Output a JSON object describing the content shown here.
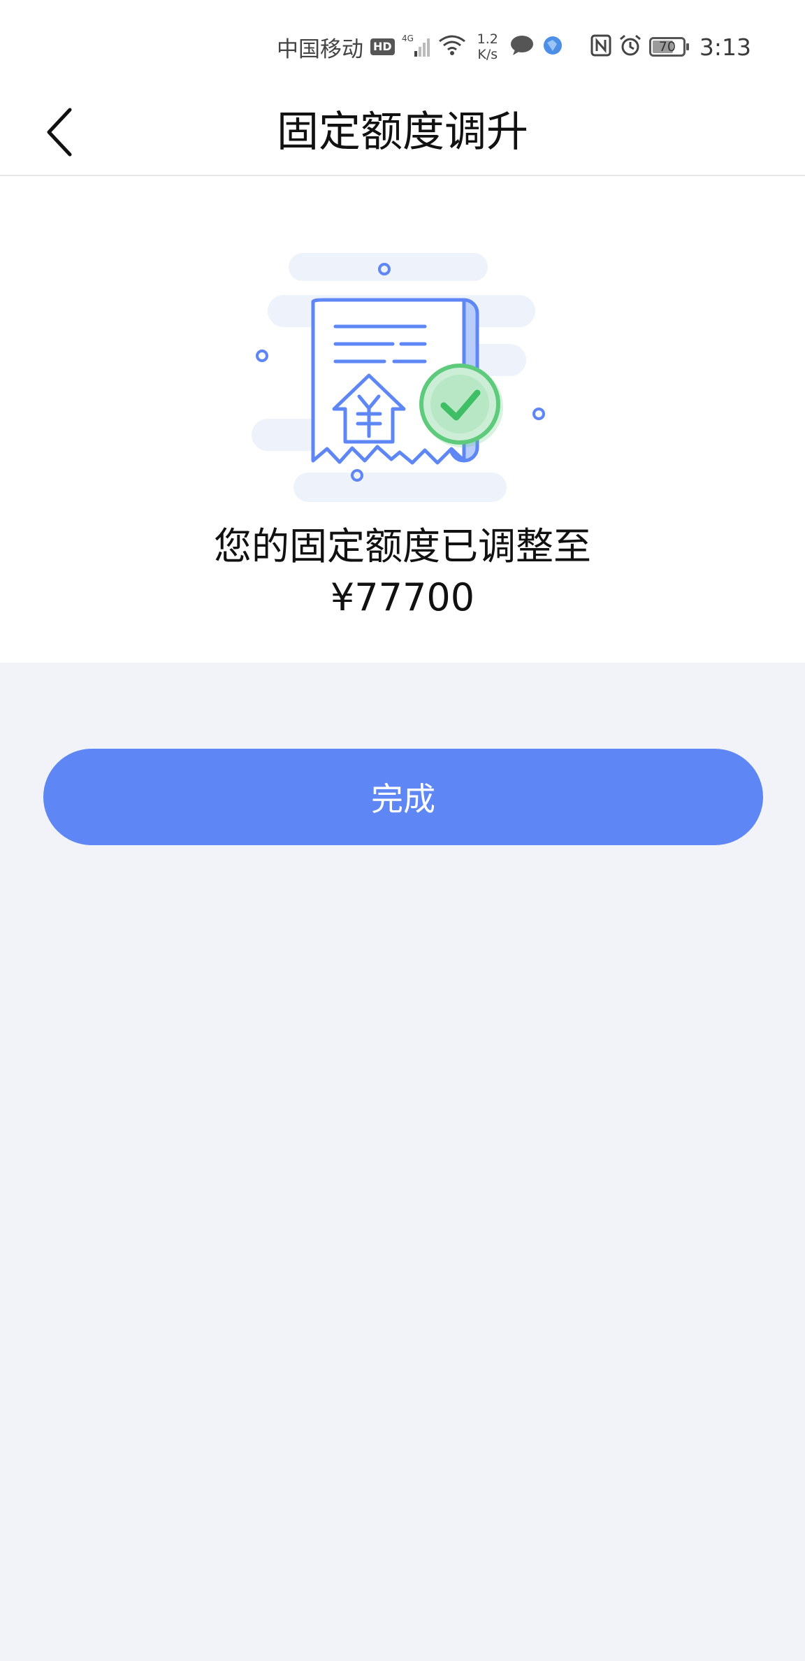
{
  "status_bar": {
    "carrier": "中国移动",
    "hd": "HD",
    "network_type": "4G",
    "speed_value": "1.2",
    "speed_unit": "K/s",
    "battery": "70",
    "battery_level": 0.7,
    "time": "3:13"
  },
  "header": {
    "title": "固定额度调升",
    "back_icon": "chevron-left-icon"
  },
  "result": {
    "message": "您的固定额度已调整至",
    "amount": "¥77700",
    "illustration_icon": "receipt-success-icon"
  },
  "actions": {
    "done_label": "完成"
  },
  "colors": {
    "primary": "#5e86f5",
    "success": "#5ecb7c",
    "page_bg": "#f1f3f8",
    "illustration_bg": "#eef2fb"
  }
}
